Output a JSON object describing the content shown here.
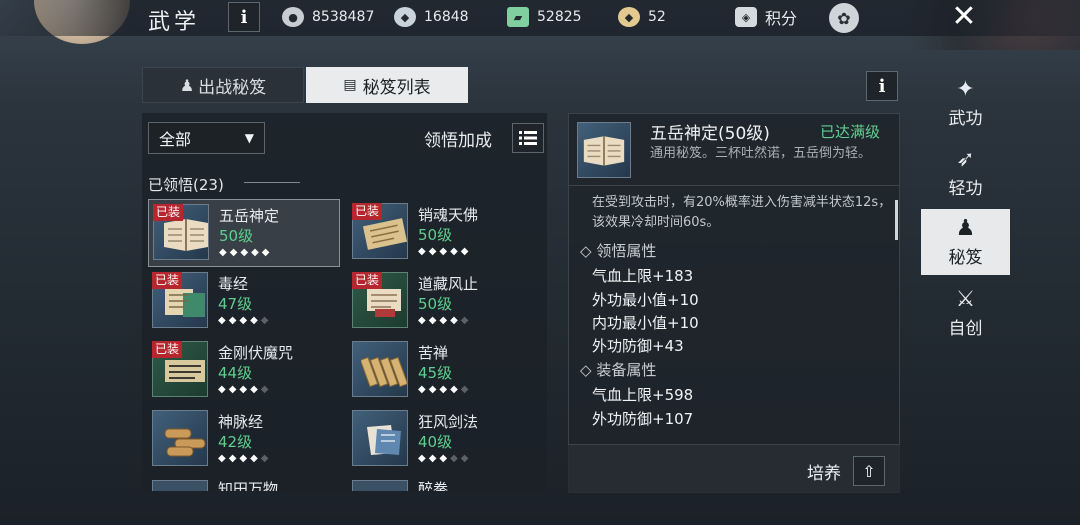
{
  "header": {
    "title": "武学",
    "resources": [
      {
        "icon": "copper-coin-icon",
        "value": "8538487",
        "color": "#c9cdd1"
      },
      {
        "icon": "silver-ingot-icon",
        "value": "16848",
        "color": "#c9d3dc"
      },
      {
        "icon": "jade-token-icon",
        "value": "52825",
        "color": "#7fcf9f"
      },
      {
        "icon": "gold-ingot-icon",
        "value": "52",
        "color": "#e2c98f"
      }
    ],
    "score_label": "积分"
  },
  "tabs": [
    {
      "label": "出战秘笈",
      "active": false
    },
    {
      "label": "秘笈列表",
      "active": true
    }
  ],
  "filter": {
    "selected": "全部"
  },
  "insight_label": "领悟加成",
  "learned_label": "已领悟(23)",
  "equipped_badge": "已装",
  "books": [
    {
      "name": "五岳神定",
      "level": "50级",
      "stars": 5,
      "equipped": true,
      "selected": true,
      "icon": "open-book-icon"
    },
    {
      "name": "销魂天佛",
      "level": "50级",
      "stars": 5,
      "equipped": true,
      "selected": false,
      "icon": "scroll-icon"
    },
    {
      "name": "毒经",
      "level": "47级",
      "stars": 4,
      "equipped": true,
      "selected": false,
      "icon": "green-scroll-icon"
    },
    {
      "name": "道藏风止",
      "level": "50级",
      "stars": 4,
      "equipped": true,
      "selected": false,
      "icon": "red-scroll-icon"
    },
    {
      "name": "金刚伏魔咒",
      "level": "44级",
      "stars": 4,
      "equipped": true,
      "selected": false,
      "icon": "dark-scroll-icon"
    },
    {
      "name": "苦禅",
      "level": "45级",
      "stars": 4,
      "equipped": false,
      "selected": false,
      "icon": "bamboo-slips-icon"
    },
    {
      "name": "神脉经",
      "level": "42级",
      "stars": 4,
      "equipped": false,
      "selected": false,
      "icon": "scroll-bundle-icon"
    },
    {
      "name": "狂风剑法",
      "level": "40级",
      "stars": 3,
      "equipped": false,
      "selected": false,
      "icon": "manual-book-icon"
    }
  ],
  "books_partial": [
    {
      "name": "知田万物"
    },
    {
      "name": "醉拳"
    }
  ],
  "detail": {
    "name": "五岳神定(50级)",
    "status": "已达满级",
    "description": "通用秘笈。三杯吐然诺，五岳倒为轻。",
    "effect": "在受到攻击时，有20%概率进入伤害减半状态12s，该效果冷却时间60s。",
    "insight_section": "领悟属性",
    "insight_attrs": [
      "气血上限+183",
      "外功最小值+10",
      "内功最小值+10",
      "外功防御+43"
    ],
    "equip_section": "装备属性",
    "equip_attrs": [
      "气血上限+598",
      "外功防御+107"
    ]
  },
  "cultivate_label": "培养",
  "side_nav": [
    {
      "label": "武功",
      "icon": "martial-pose-icon",
      "active": false
    },
    {
      "label": "轻功",
      "icon": "running-figure-icon",
      "active": false
    },
    {
      "label": "秘笈",
      "icon": "meditating-figure-icon",
      "active": true
    },
    {
      "label": "自创",
      "icon": "crossed-swords-icon",
      "active": false
    }
  ]
}
